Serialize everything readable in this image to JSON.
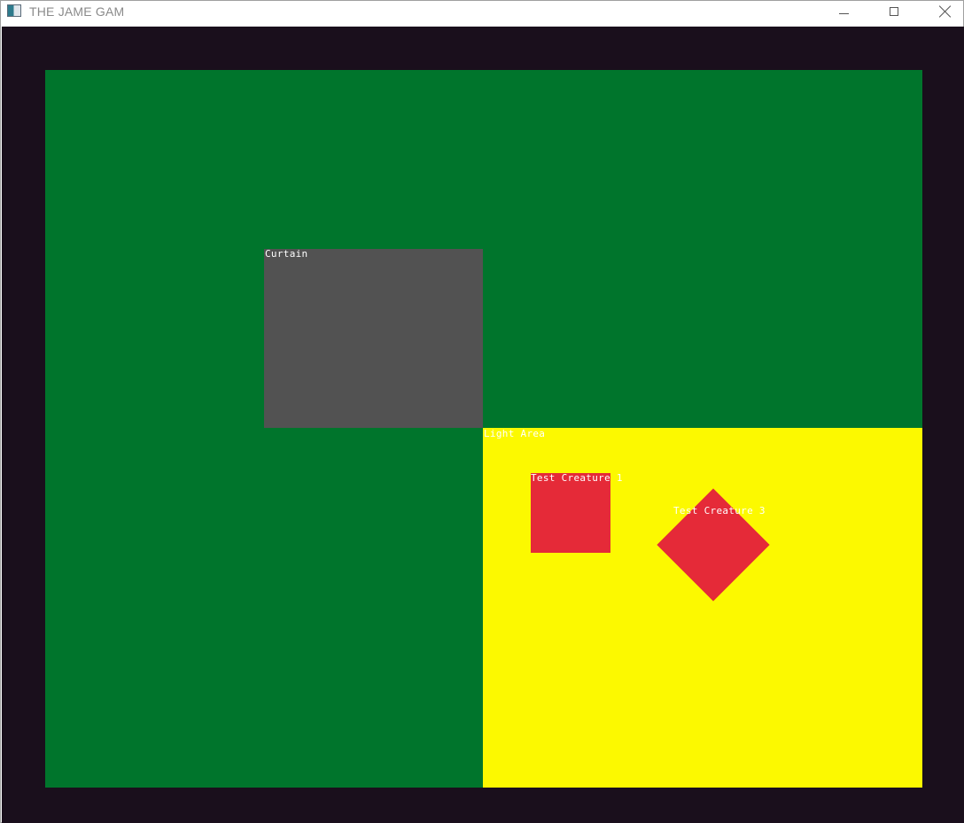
{
  "window": {
    "title": "THE JAME GAM",
    "controls": {
      "minimize_icon": "minimize-icon",
      "maximize_icon": "maximize-icon",
      "close_icon": "close-icon"
    }
  },
  "game": {
    "colors": {
      "background": "#1a0f1c",
      "ground": "#00752c",
      "curtain": "#525252",
      "light_area": "#fcf900",
      "creature": "#e52a38",
      "label": "#ffffff"
    },
    "entities": {
      "curtain": {
        "label": "Curtain"
      },
      "light_area": {
        "label": "Light Area"
      },
      "creature_1": {
        "label": "Test Creature 1"
      },
      "creature_3": {
        "label": "Test Creature 3"
      }
    }
  }
}
